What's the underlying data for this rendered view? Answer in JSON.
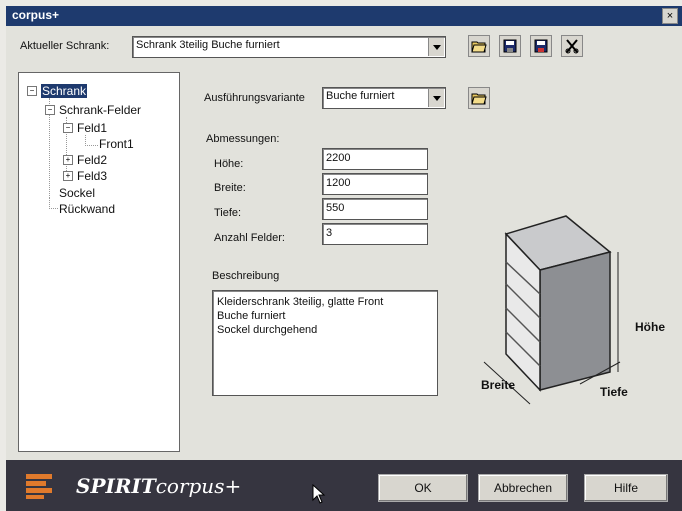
{
  "window": {
    "title": "corpus+",
    "close_glyph": "×"
  },
  "toolbar": {
    "current_label": "Aktueller Schrank:",
    "current_value": "Schrank 3teilig Buche furniert",
    "icons": [
      "open-folder-icon",
      "save-icon",
      "save-as-icon",
      "delete-icon"
    ]
  },
  "tree": {
    "items": [
      {
        "label": "Schrank"
      },
      {
        "label": "Schrank-Felder"
      },
      {
        "label": "Feld1"
      },
      {
        "label": "Front1"
      },
      {
        "label": "Feld2"
      },
      {
        "label": "Feld3"
      },
      {
        "label": "Sockel"
      },
      {
        "label": "Rückwand"
      }
    ],
    "expander_minus": "−",
    "expander_plus": "+"
  },
  "form": {
    "variant_label": "Ausführungsvariante",
    "variant_value": "Buche furniert",
    "dims_heading": "Abmessungen:",
    "fields": [
      {
        "label": "Höhe:",
        "value": "2200"
      },
      {
        "label": "Breite:",
        "value": "1200"
      },
      {
        "label": "Tiefe:",
        "value": "550"
      },
      {
        "label": "Anzahl Felder:",
        "value": "3"
      }
    ],
    "desc_heading": "Beschreibung",
    "desc_lines": [
      "Kleiderschrank 3teilig, glatte Front",
      "Buche furniert",
      "Sockel durchgehend"
    ]
  },
  "diagram": {
    "height_label": "Höhe",
    "width_label": "Breite",
    "depth_label": "Tiefe"
  },
  "footer": {
    "brand_spirit": "SPIRIT",
    "brand_rest": "corpus+",
    "ok": "OK",
    "cancel": "Abbrechen",
    "help": "Hilfe"
  },
  "colors": {
    "titlebar": "#1e3a6e",
    "footer": "#363540",
    "panel": "#e2e2dc"
  }
}
